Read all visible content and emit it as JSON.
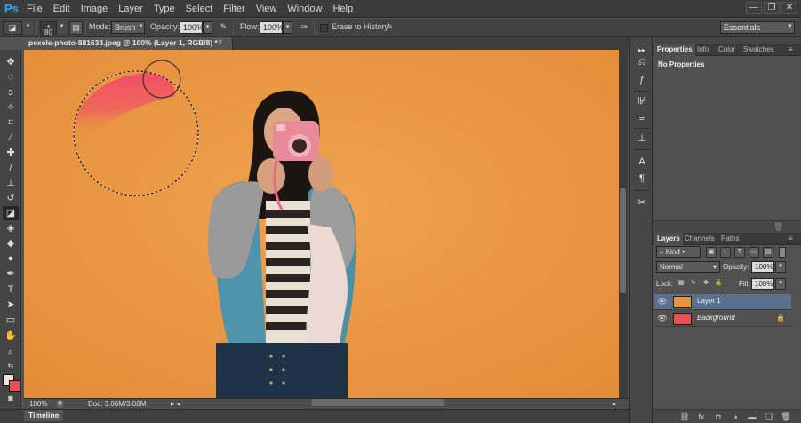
{
  "app": {
    "logo": "Ps"
  },
  "menu": [
    "File",
    "Edit",
    "Image",
    "Layer",
    "Type",
    "Select",
    "Filter",
    "View",
    "Window",
    "Help"
  ],
  "window_controls": {
    "minimize": "—",
    "restore": "❐",
    "close": "✕"
  },
  "options_bar": {
    "brush_size": "80",
    "mode_label": "Mode:",
    "mode_value": "Brush",
    "opacity_label": "Opacity:",
    "opacity_value": "100%",
    "flow_label": "Flow:",
    "flow_value": "100%",
    "erase_history_label": "Erase to History",
    "erase_history_checked": false,
    "workspace": "Essentials"
  },
  "document": {
    "tab_title": "pexels-photo-881633.jpeg @ 100% (Layer 1, RGB/8) *",
    "close": "×"
  },
  "status": {
    "zoom": "100%",
    "doc_info": "Doc: 3.06M/3.06M"
  },
  "timeline": {
    "label": "Timeline"
  },
  "properties_panel": {
    "tabs": [
      "Properties",
      "Info",
      "Color",
      "Swatches"
    ],
    "active_tab": "Properties",
    "message": "No Properties"
  },
  "layers_panel": {
    "tabs": [
      "Layers",
      "Channels",
      "Paths"
    ],
    "active_tab": "Layers",
    "filter_kind": "Kind",
    "blend_mode": "Normal",
    "opacity_label": "Opacity:",
    "opacity_value": "100%",
    "lock_label": "Lock:",
    "fill_label": "Fill:",
    "fill_value": "100%",
    "layers": [
      {
        "name": "Layer 1",
        "selected": true,
        "visible": true,
        "thumb_color": "#e8943c"
      },
      {
        "name": "Background",
        "selected": false,
        "visible": true,
        "locked": true,
        "thumb_color": "#eb4d55"
      }
    ]
  },
  "colors": {
    "foreground": "#efe6d6",
    "background": "#eb4d55",
    "canvas_bg": "#eb9844",
    "accent": "#31a8ff",
    "selected_layer": "#5b6f8f"
  }
}
